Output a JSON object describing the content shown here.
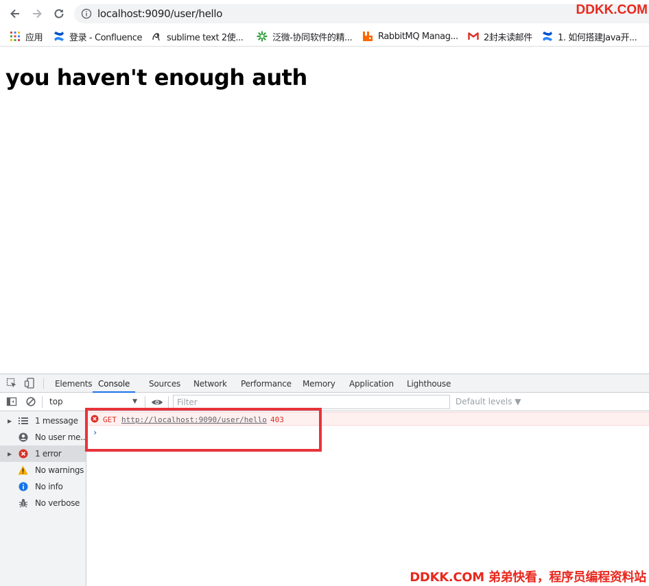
{
  "browser": {
    "url": "localhost:9090/user/hello",
    "watermark": "DDKK.COM"
  },
  "bookmarks": [
    {
      "label": "应用",
      "icon": "apps-grid-icon"
    },
    {
      "label": "登录 - Confluence",
      "icon": "confluence-icon"
    },
    {
      "label": "sublime text 2使...",
      "icon": "sublime-icon"
    },
    {
      "label": "泛微-协同软件的精...",
      "icon": "weaver-icon"
    },
    {
      "label": "RabbitMQ Manag...",
      "icon": "rabbitmq-icon"
    },
    {
      "label": "2封未读邮件",
      "icon": "gmail-icon"
    },
    {
      "label": "1. 如何搭建Java开...",
      "icon": "confluence-icon"
    }
  ],
  "page": {
    "heading": "you haven't enough auth"
  },
  "devtools": {
    "tabs": [
      "Elements",
      "Console",
      "Sources",
      "Network",
      "Performance",
      "Memory",
      "Application",
      "Lighthouse"
    ],
    "active_tab": "Console",
    "context": "top",
    "filter_placeholder": "Filter",
    "levels": "Default levels ▼",
    "sidebar": [
      {
        "label": "1 message",
        "icon": "list-icon"
      },
      {
        "label": "No user me...",
        "icon": "user-icon"
      },
      {
        "label": "1 error",
        "icon": "error-icon"
      },
      {
        "label": "No warnings",
        "icon": "warning-icon"
      },
      {
        "label": "No info",
        "icon": "info-icon"
      },
      {
        "label": "No verbose",
        "icon": "bug-icon"
      }
    ],
    "console": {
      "error": {
        "method": "GET",
        "url": "http://localhost:9090/user/hello",
        "status": "403"
      },
      "prompt": "›"
    }
  },
  "footer_watermark": "DDKK.COM 弟弟快看，程序员编程资料站",
  "colors": {
    "accent_blue": "#1a73e8",
    "error_red": "#d93026",
    "highlight_red": "#e8333a",
    "watermark_red": "#e8281e"
  }
}
